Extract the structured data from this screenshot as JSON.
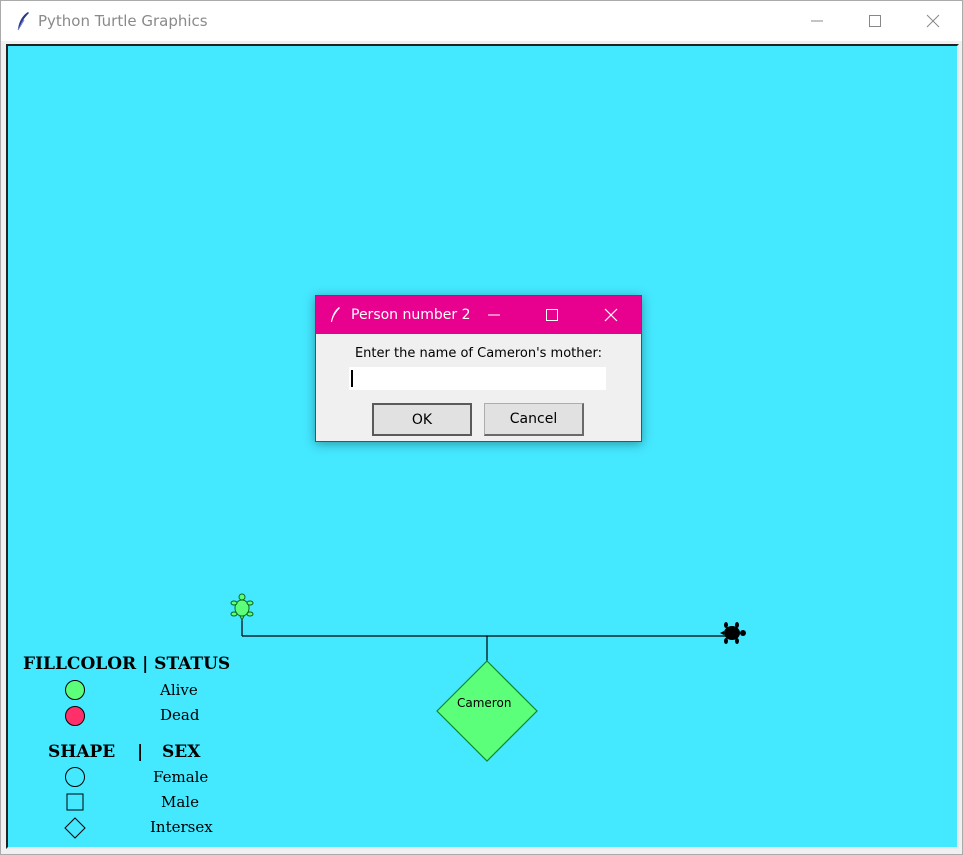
{
  "window": {
    "title": "Python Turtle Graphics"
  },
  "colors": {
    "canvas_bg": "#44e8ff",
    "alive": "#5cff7a",
    "dead": "#ff2f6a",
    "dialog_accent": "#e8008f"
  },
  "legend": {
    "fillcolor_header": "FILLCOLOR | STATUS",
    "alive_label": "Alive",
    "dead_label": "Dead",
    "shape_header": "SHAPE",
    "separator": "|",
    "sex_header": "SEX",
    "female_label": "Female",
    "male_label": "Male",
    "intersex_label": "Intersex"
  },
  "tree": {
    "person_name": "Cameron",
    "person_shape": "diamond",
    "person_status": "alive"
  },
  "dialog": {
    "title": "Person number 2",
    "prompt": "Enter the name of Cameron's mother:",
    "input_value": "",
    "ok_label": "OK",
    "cancel_label": "Cancel"
  }
}
